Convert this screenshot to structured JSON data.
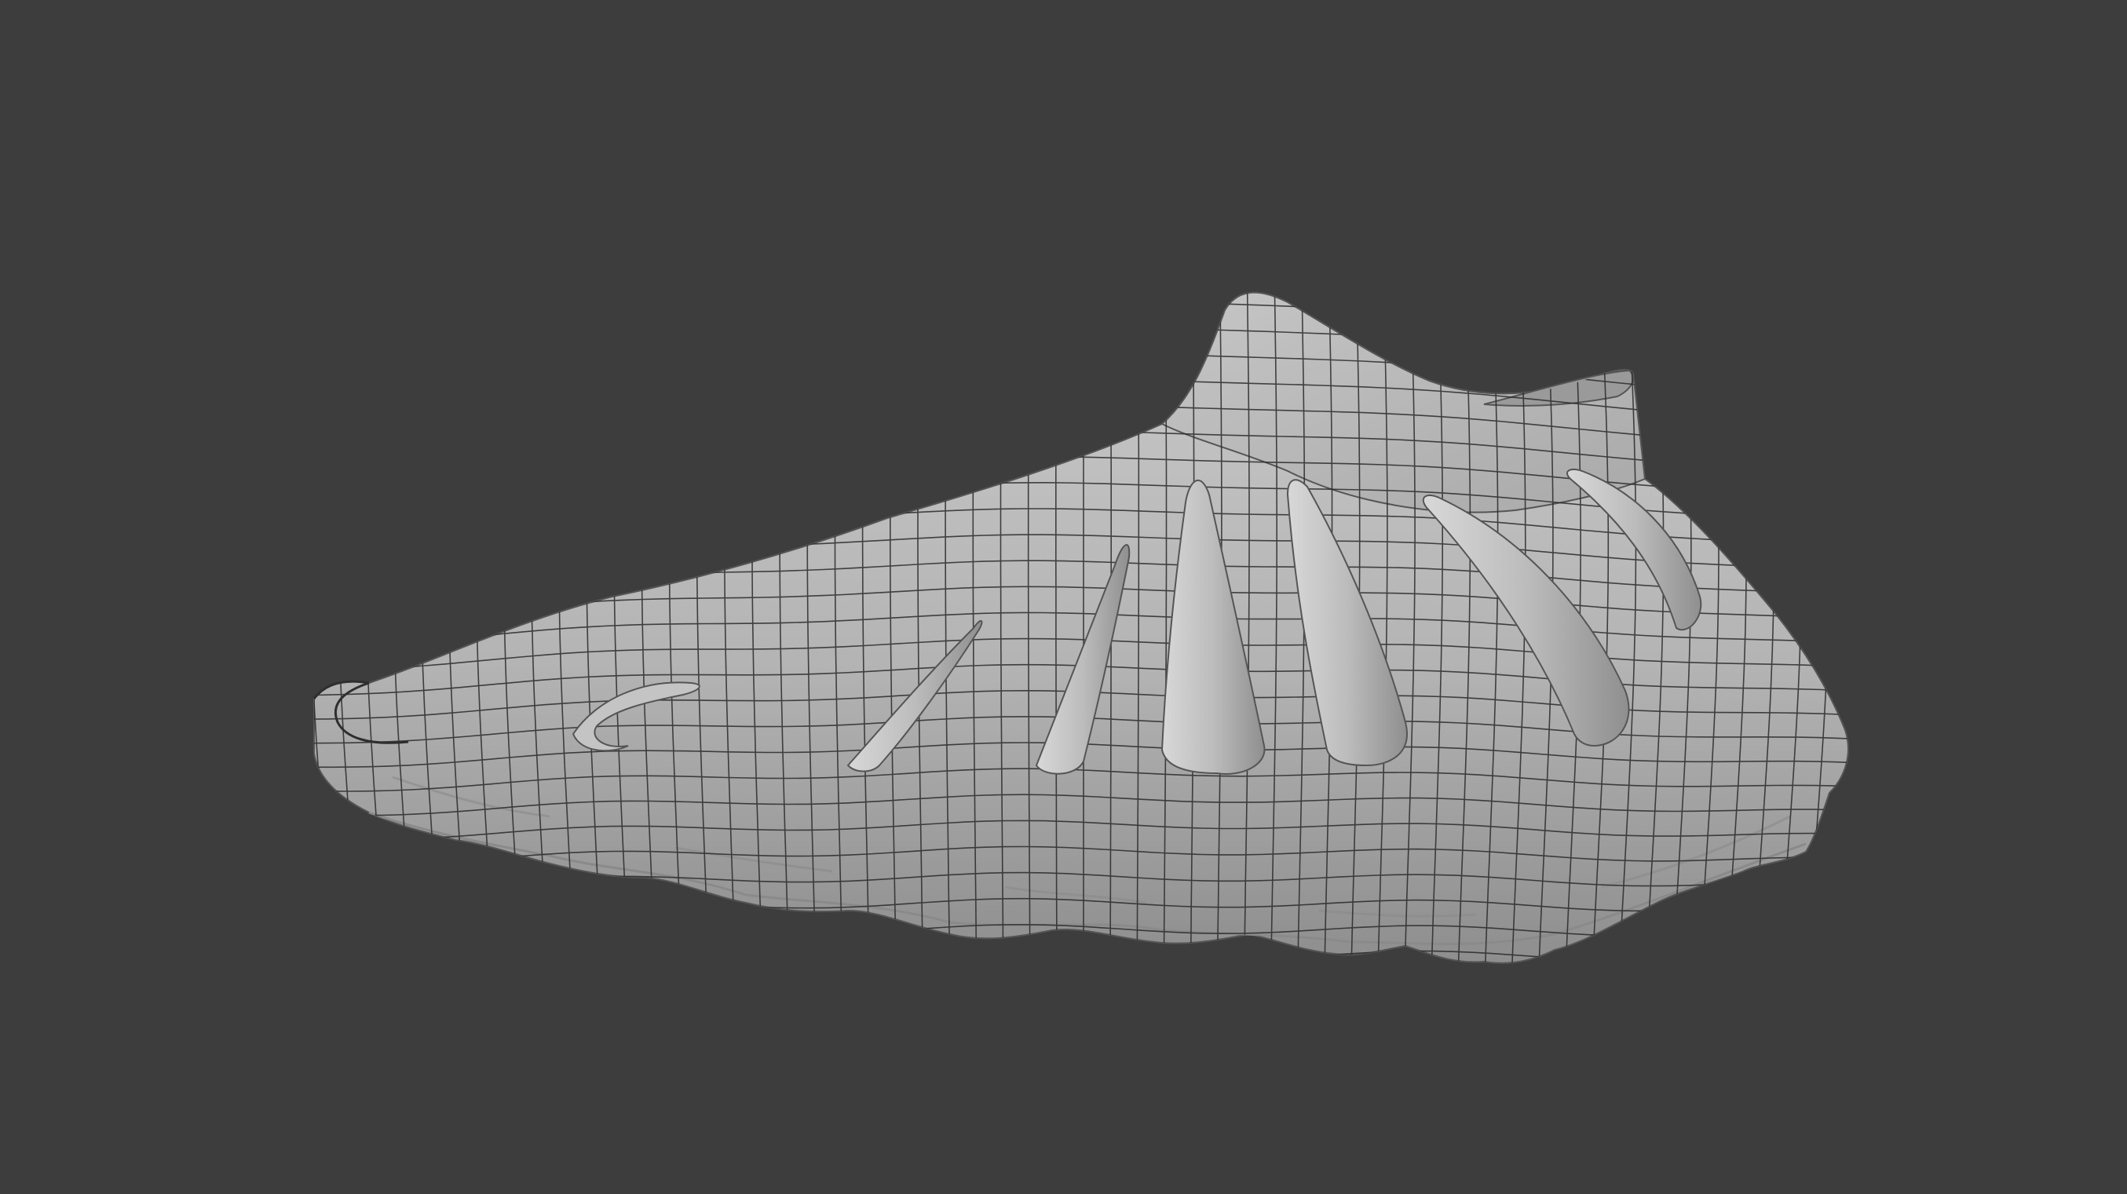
{
  "viewport": {
    "background_color": "#3d3d3d",
    "mesh_color": "#b7b7b7",
    "wire_color": "#2a2a2a"
  }
}
